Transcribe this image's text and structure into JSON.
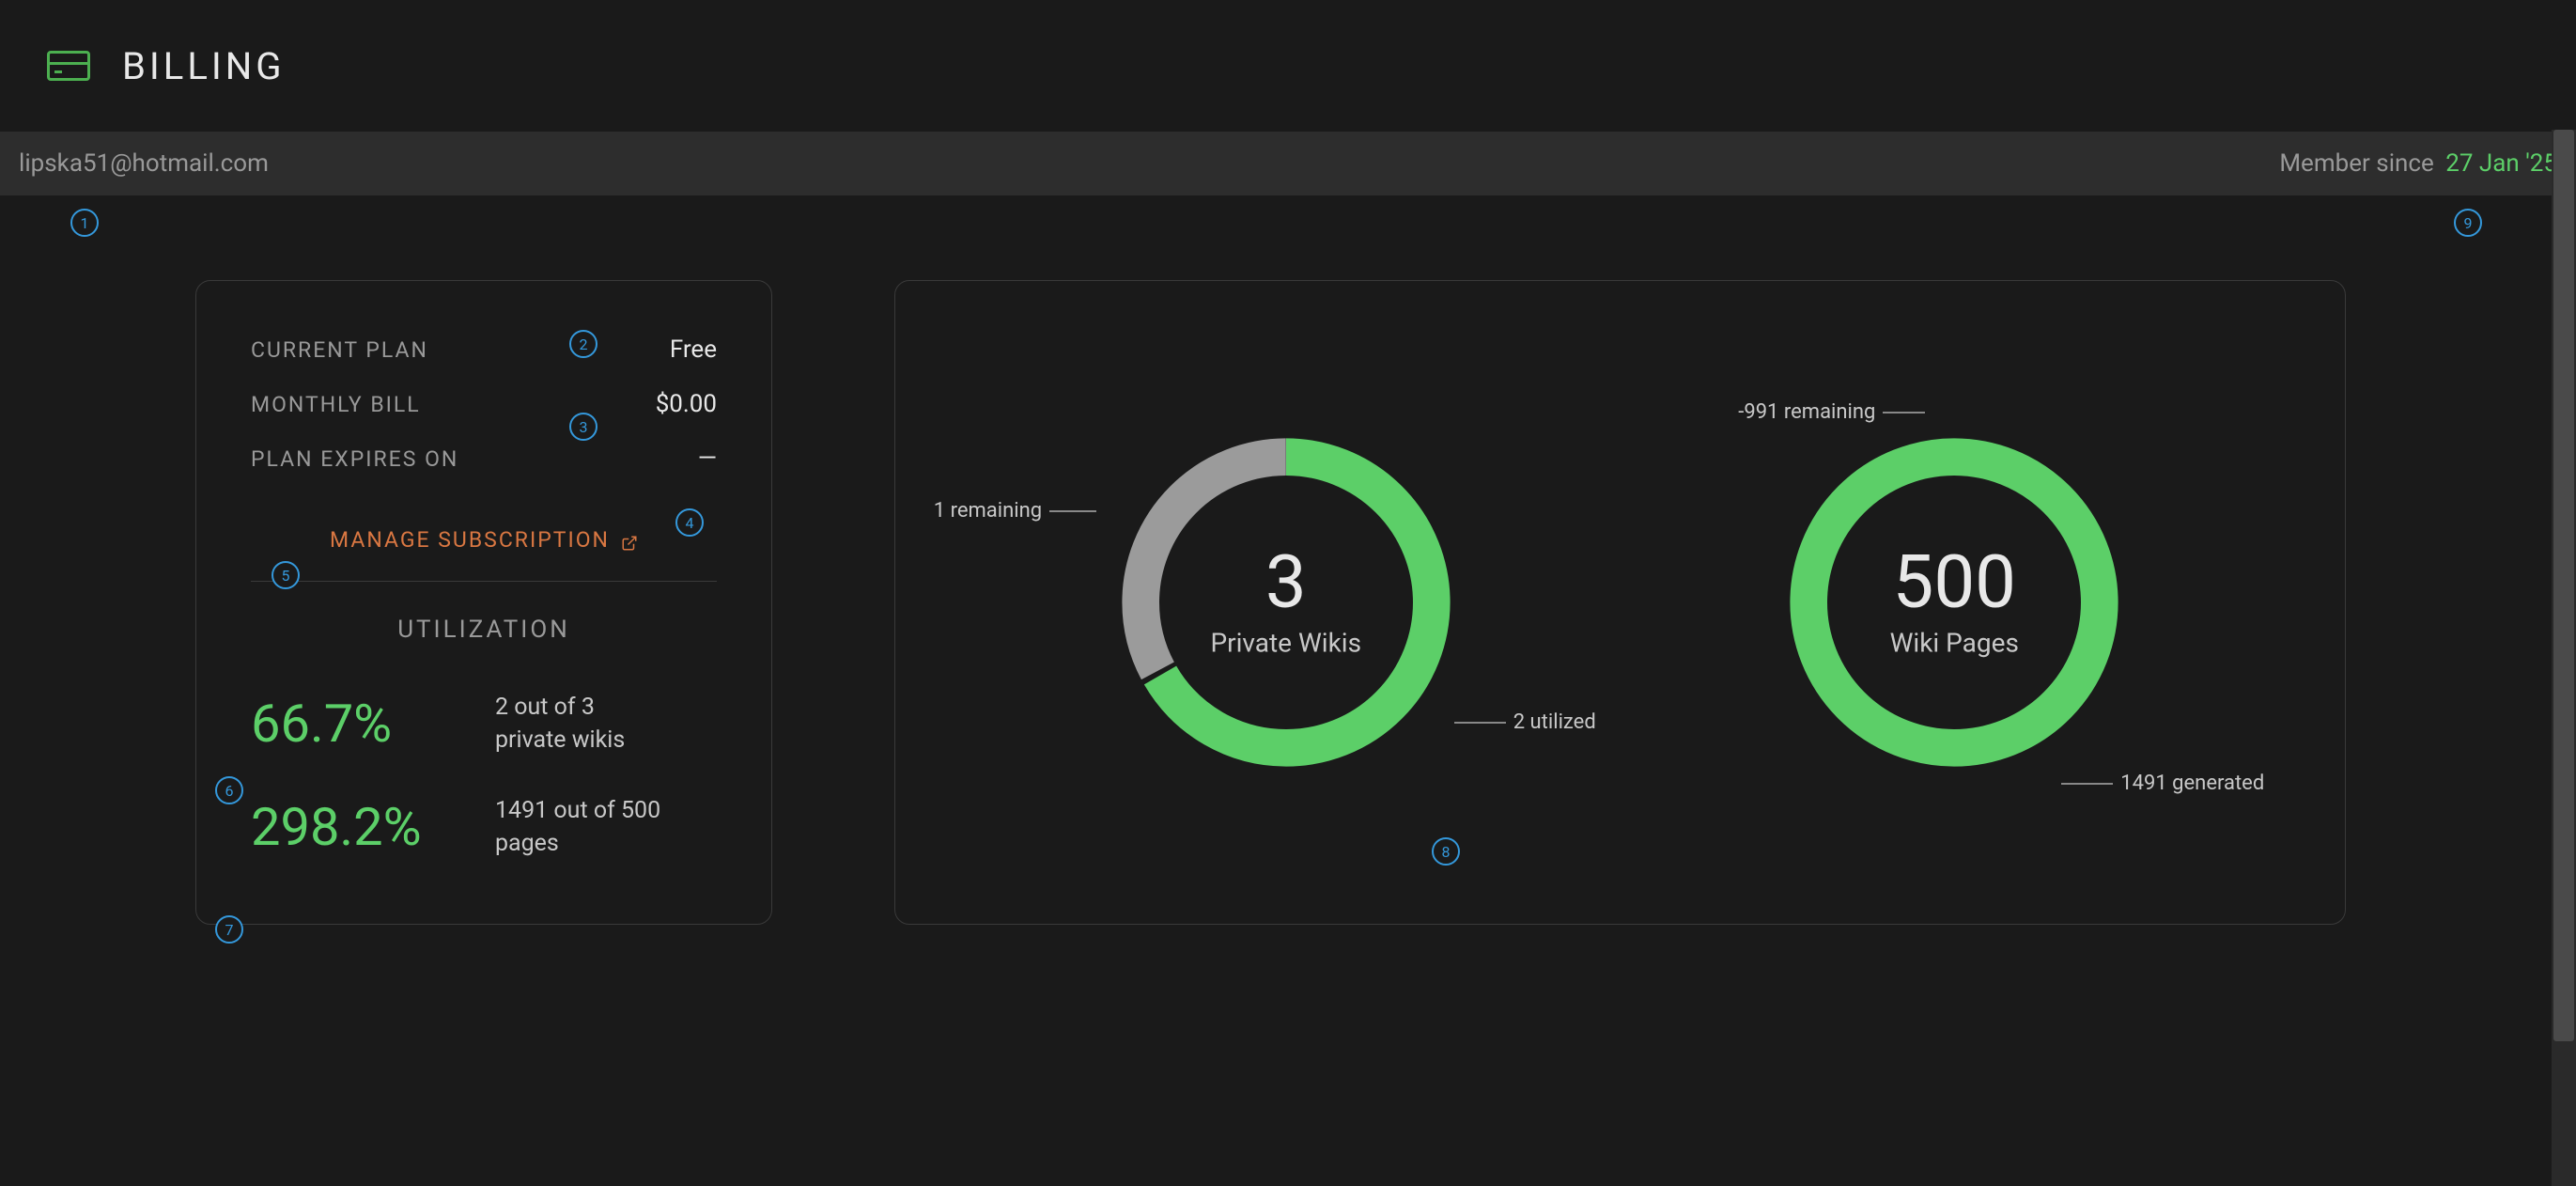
{
  "header": {
    "title": "BILLING"
  },
  "subheader": {
    "email": "lipska51@hotmail.com",
    "member_label": "Member since",
    "member_date": "27 Jan '25"
  },
  "plan": {
    "current_label": "CURRENT PLAN",
    "current_value": "Free",
    "monthly_label": "MONTHLY BILL",
    "monthly_value": "$0.00",
    "expires_label": "PLAN EXPIRES ON",
    "expires_value": "—",
    "manage_label": "MANAGE SUBSCRIPTION",
    "util_title": "UTILIZATION",
    "wikis_pct": "66.7%",
    "wikis_desc1": "2 out of 3",
    "wikis_desc2": "private wikis",
    "pages_pct": "298.2%",
    "pages_desc1": "1491 out of 500",
    "pages_desc2": "pages"
  },
  "donuts": {
    "wikis": {
      "number": "3",
      "label": "Private Wikis",
      "remaining": "1 remaining",
      "utilized": "2 utilized"
    },
    "pages": {
      "number": "500",
      "label": "Wiki Pages",
      "remaining": "-991 remaining",
      "generated": "1491 generated"
    }
  },
  "markers": {
    "m1": "1",
    "m2": "2",
    "m3": "3",
    "m4": "4",
    "m5": "5",
    "m6": "6",
    "m7": "7",
    "m8": "8",
    "m9": "9"
  },
  "chart_data": [
    {
      "type": "pie",
      "title": "Private Wikis",
      "series": [
        {
          "name": "utilized",
          "value": 2
        },
        {
          "name": "remaining",
          "value": 1
        }
      ],
      "total": 3,
      "colors": {
        "utilized": "#5CCF68",
        "remaining": "#9b9b9b"
      }
    },
    {
      "type": "pie",
      "title": "Wiki Pages",
      "series": [
        {
          "name": "generated",
          "value": 1491
        },
        {
          "name": "remaining",
          "value": -991
        }
      ],
      "total": 500,
      "colors": {
        "generated": "#5CCF68"
      }
    }
  ]
}
